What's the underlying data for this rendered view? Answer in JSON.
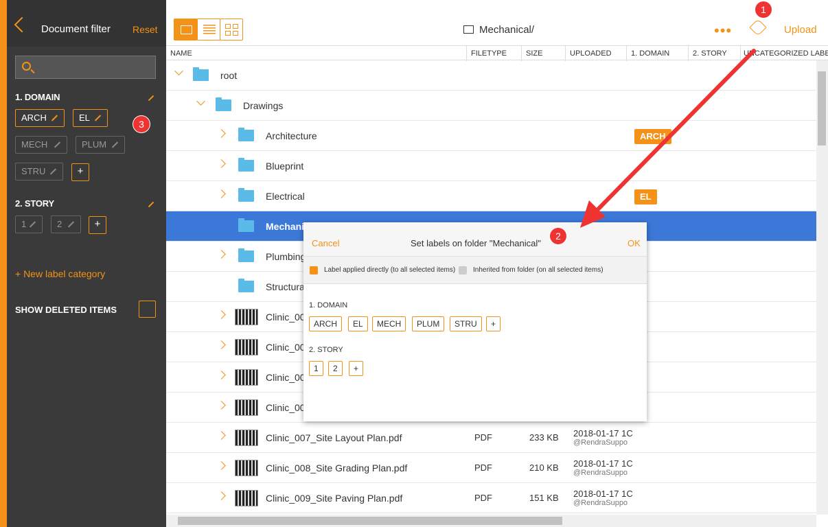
{
  "sidebar": {
    "title": "Document filter",
    "reset": "Reset",
    "search_placeholder": "",
    "categories": [
      {
        "name": "1. DOMAIN",
        "labels": [
          {
            "text": "ARCH",
            "active": true
          },
          {
            "text": "EL",
            "active": true
          },
          {
            "text": "MECH",
            "active": false
          },
          {
            "text": "PLUM",
            "active": false
          },
          {
            "text": "STRU",
            "active": false
          }
        ],
        "add": "+"
      },
      {
        "name": "2. STORY",
        "labels": [
          {
            "text": "1",
            "active": false
          },
          {
            "text": "2",
            "active": false
          }
        ],
        "add": "+"
      }
    ],
    "new_category": "+ New label category",
    "show_deleted": "SHOW DELETED ITEMS"
  },
  "toolbar": {
    "path": "Mechanical/",
    "more": "•••",
    "upload": "Upload"
  },
  "table": {
    "columns": [
      "NAME",
      "FILETYPE",
      "SIZE",
      "UPLOADED",
      "1. DOMAIN",
      "2. STORY",
      "UNCATEGORIZED LABE"
    ],
    "rows": [
      {
        "name": "root",
        "label": ""
      },
      {
        "name": "Drawings",
        "label": ""
      },
      {
        "name": "Architecture",
        "label": "ARCH"
      },
      {
        "name": "Blueprint",
        "label": ""
      },
      {
        "name": "Electrical",
        "label": "EL"
      },
      {
        "name": "Mechanic",
        "label": ""
      },
      {
        "name": "Plumbing",
        "label": ""
      },
      {
        "name": "Structura",
        "label": ""
      },
      {
        "name": "Clinic_00",
        "label": ""
      },
      {
        "name": "Clinic_00",
        "label": ""
      },
      {
        "name": "Clinic_00",
        "label": ""
      },
      {
        "name": "Clinic_00",
        "label": ""
      },
      {
        "name": "Clinic_007_Site Layout Plan.pdf",
        "type": "PDF",
        "size": "233 KB",
        "date": "2018-01-17 1C",
        "user": "@RendraSuppo"
      },
      {
        "name": "Clinic_008_Site Grading Plan.pdf",
        "type": "PDF",
        "size": "210 KB",
        "date": "2018-01-17 1C",
        "user": "@RendraSuppo"
      },
      {
        "name": "Clinic_009_Site Paving Plan.pdf",
        "type": "PDF",
        "size": "151 KB",
        "date": "2018-01-17 1C",
        "user": "@RendraSuppo"
      }
    ]
  },
  "modal": {
    "cancel": "Cancel",
    "title": "Set labels on folder \"Mechanical\"",
    "ok": "OK",
    "legend_direct": "Label applied directly (to all selected items)",
    "legend_inherited": "Inherited from folder (on all selected items)",
    "cat1": "1. DOMAIN",
    "cat1_labels": [
      "ARCH",
      "EL",
      "MECH",
      "PLUM",
      "STRU",
      "+"
    ],
    "cat2": "2. STORY",
    "cat2_labels": [
      "1",
      "2",
      "+"
    ]
  },
  "callouts": [
    "1",
    "2",
    "3"
  ],
  "colors": {
    "accent": "#f39217",
    "selected": "#3c78d8",
    "sidebar": "#3a3a3a",
    "callout": "#e33"
  }
}
